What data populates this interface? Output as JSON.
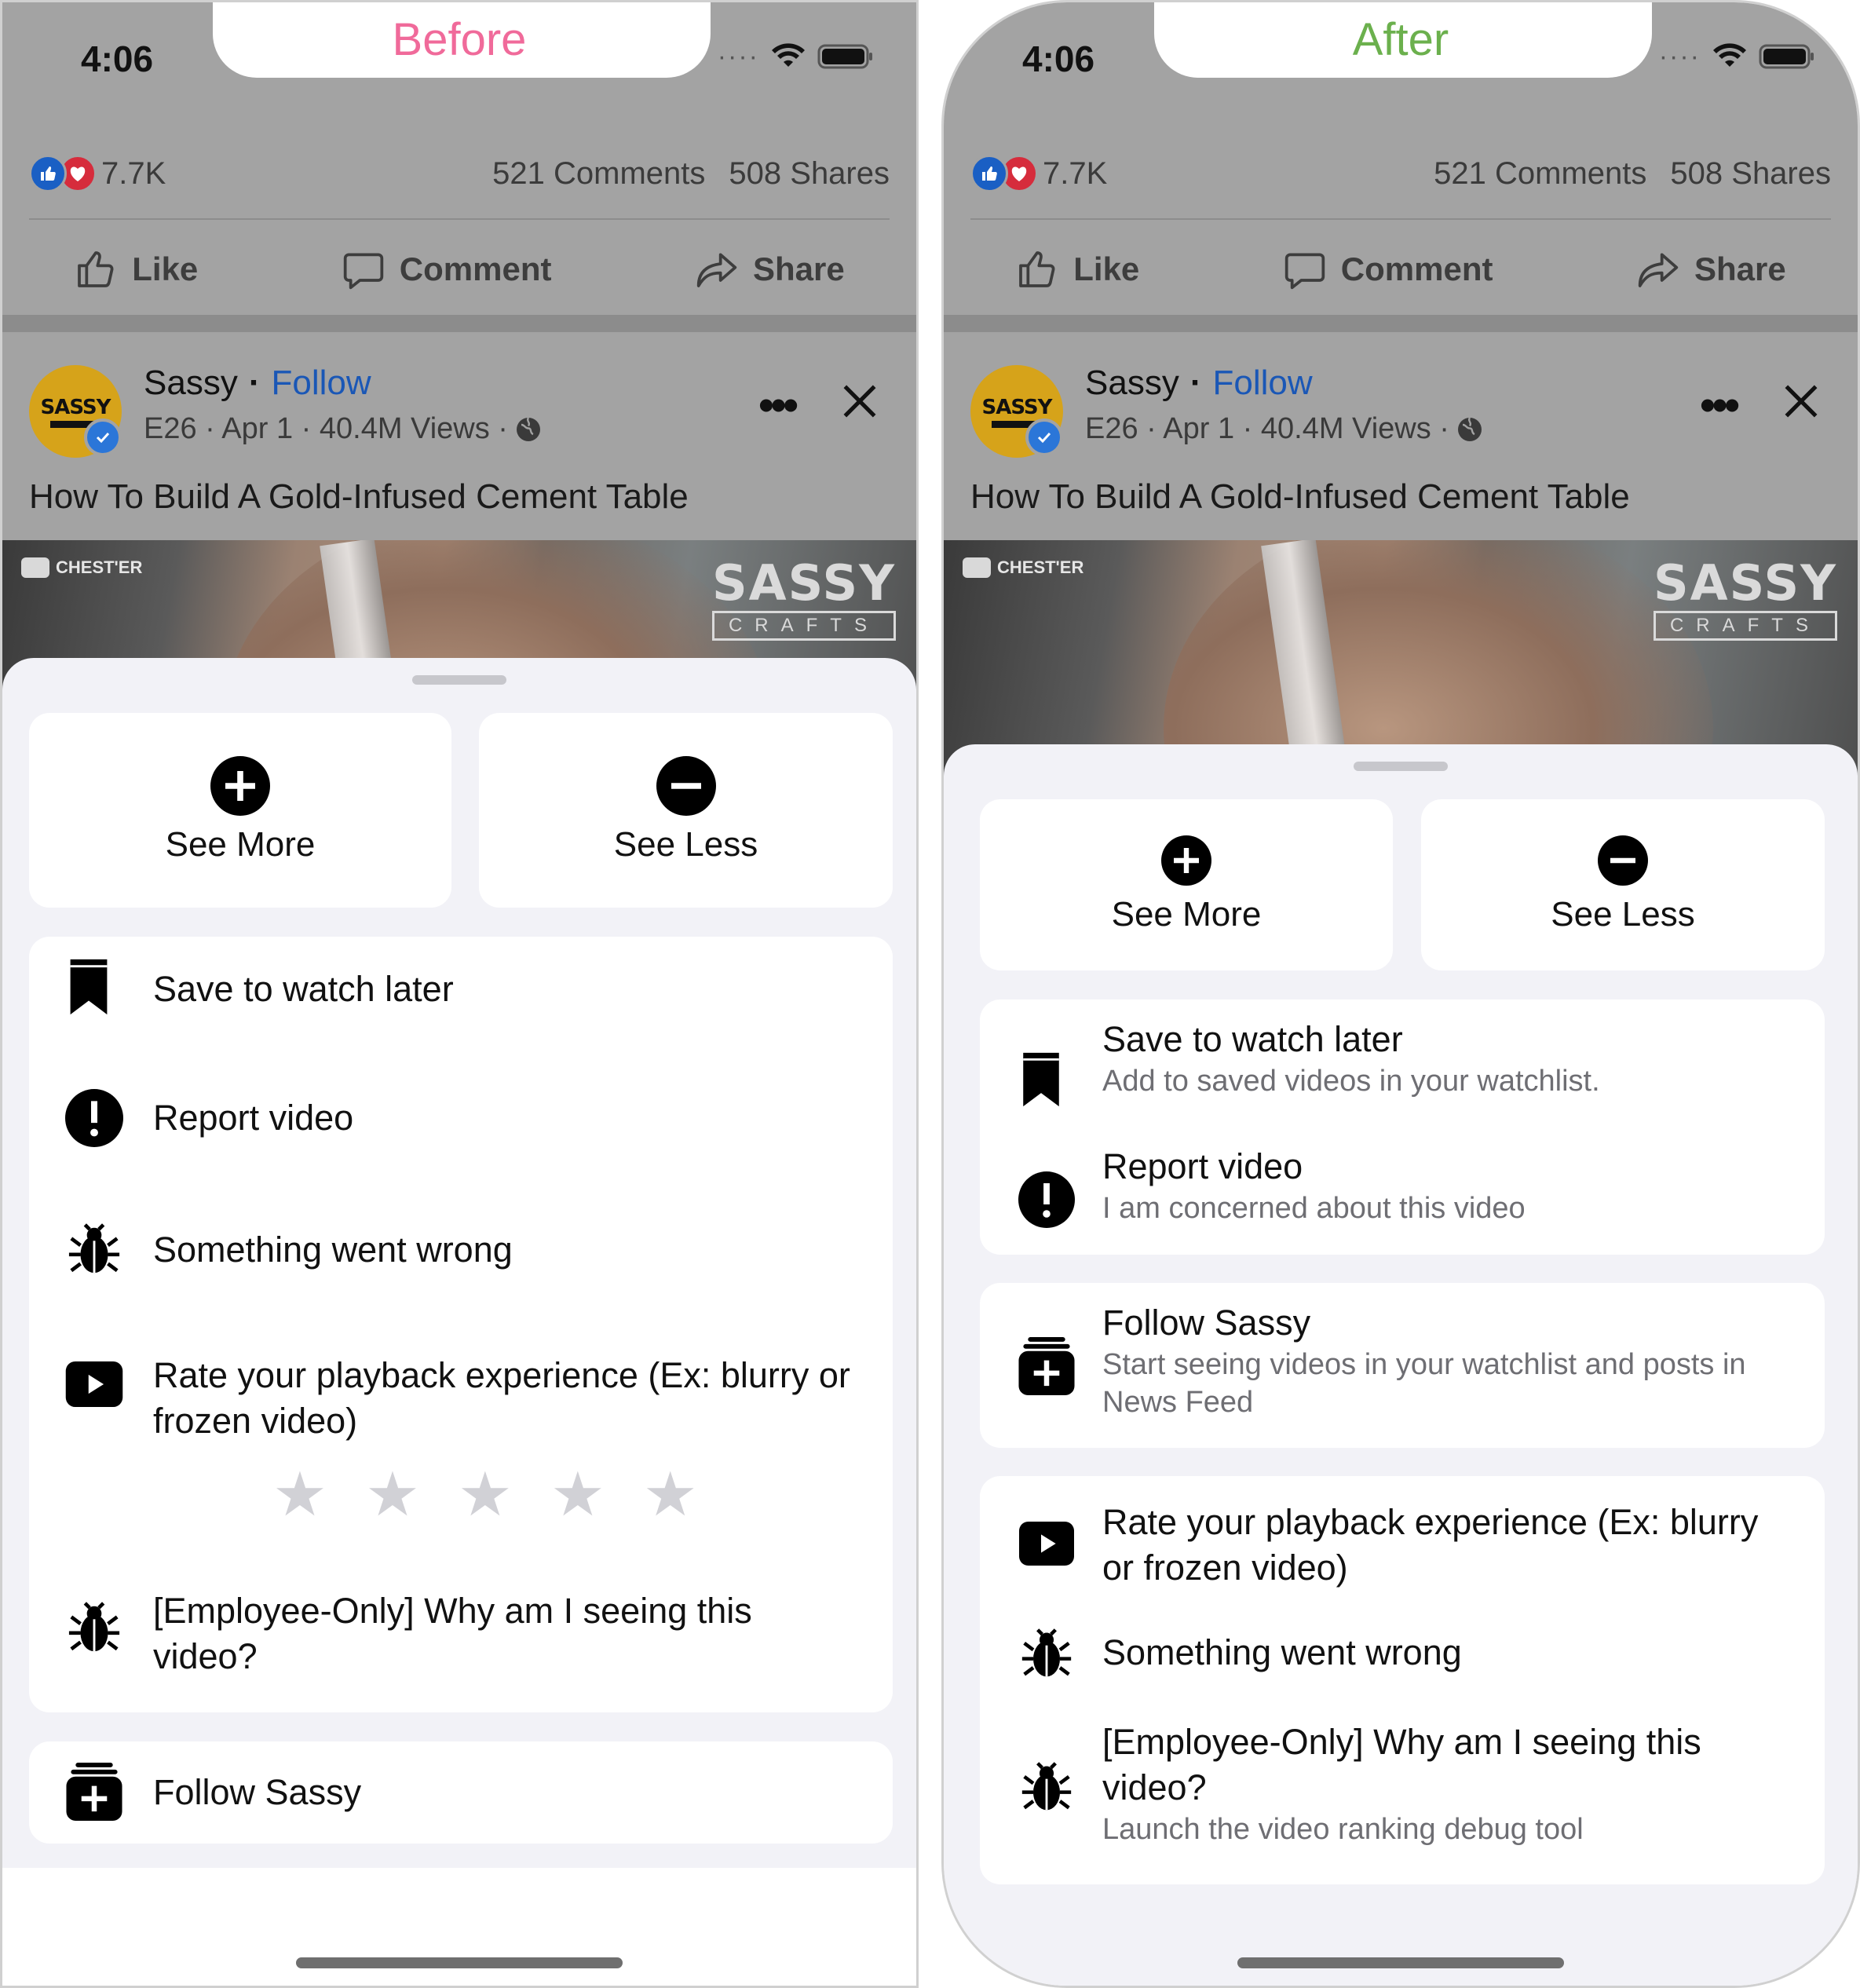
{
  "panels": {
    "before": {
      "label": "Before",
      "label_color": "#f06a9a",
      "status": {
        "time": "4:06"
      },
      "feed": {
        "reaction_count": "7.7K",
        "comments": "521 Comments",
        "shares": "508 Shares",
        "actions": {
          "like": "Like",
          "comment": "Comment",
          "share": "Share"
        },
        "post": {
          "author": "Sassy",
          "follow": "Follow",
          "meta": "E26 · Apr 1 · 40.4M Views ·",
          "title": "How To Build A Gold-Infused Cement Table",
          "avatar_text": "SASSY",
          "video_badge": "CHEST'ER",
          "video_logo": "SASSY",
          "video_logo_sub": "CRAFTS"
        }
      },
      "sheet": {
        "see_more": "See More",
        "see_less": "See Less",
        "items": [
          {
            "icon": "bookmark-icon",
            "title": "Save to watch later"
          },
          {
            "icon": "alert-icon",
            "title": "Report video"
          },
          {
            "icon": "bug-icon",
            "title": "Something went wrong"
          },
          {
            "icon": "play-icon",
            "title": "Rate your playback experience (Ex: blurry or frozen video)"
          },
          {
            "icon": "bug-icon",
            "title": "[Employee-Only] Why am I seeing this video?"
          }
        ],
        "rating_stars": 5,
        "rating_value": 0,
        "follow": {
          "icon": "follow-add-icon",
          "title": "Follow Sassy"
        }
      }
    },
    "after": {
      "label": "After",
      "label_color": "#6bb04d",
      "status": {
        "time": "4:06"
      },
      "feed": {
        "reaction_count": "7.7K",
        "comments": "521 Comments",
        "shares": "508 Shares",
        "actions": {
          "like": "Like",
          "comment": "Comment",
          "share": "Share"
        },
        "post": {
          "author": "Sassy",
          "follow": "Follow",
          "meta": "E26 · Apr 1 · 40.4M Views ·",
          "title": "How To Build A Gold-Infused Cement Table",
          "avatar_text": "SASSY",
          "video_badge": "CHEST'ER",
          "video_logo": "SASSY",
          "video_logo_sub": "CRAFTS"
        }
      },
      "sheet": {
        "see_more": "See More",
        "see_less": "See Less",
        "group1": [
          {
            "icon": "bookmark-icon",
            "title": "Save to watch later",
            "subtitle": "Add to saved videos in your watchlist."
          },
          {
            "icon": "alert-icon",
            "title": "Report video",
            "subtitle": "I am concerned about this video"
          }
        ],
        "group2": [
          {
            "icon": "follow-add-icon",
            "title": "Follow Sassy",
            "subtitle": "Start seeing videos in your watchlist and posts in News Feed"
          }
        ],
        "group3": [
          {
            "icon": "play-icon",
            "title": "Rate your playback experience (Ex: blurry or frozen video)"
          },
          {
            "icon": "bug-icon",
            "title": "Something went wrong"
          },
          {
            "icon": "bug-icon",
            "title": "[Employee-Only] Why am I seeing this video?",
            "subtitle": "Launch the video ranking debug tool"
          }
        ]
      }
    }
  },
  "colors": {
    "accent_link": "#1a57b6",
    "dim_overlay": "#a3a3a3",
    "sheet_bg": "#f2f2f7",
    "star_empty": "#d1d1d6"
  }
}
